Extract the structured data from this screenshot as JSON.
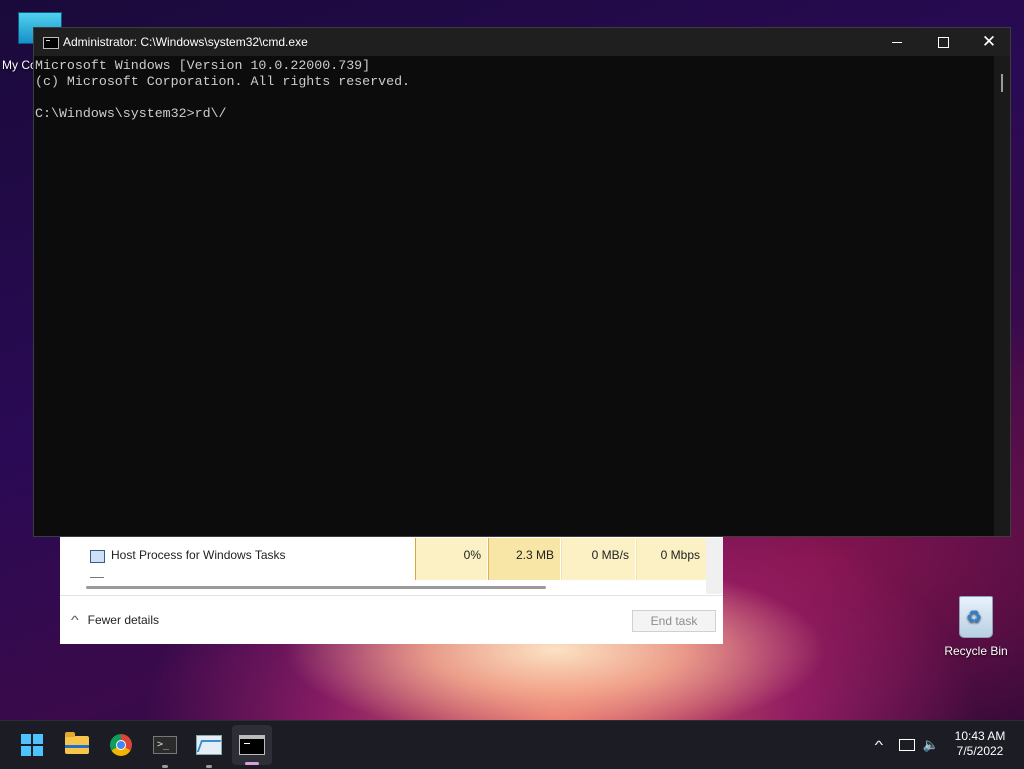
{
  "desktop": {
    "my_computer_label": "My Co",
    "recycle_bin_label": "Recycle Bin"
  },
  "taskmgr": {
    "row": {
      "name": "Host Process for Windows Tasks",
      "cpu": "0%",
      "memory": "2.3 MB",
      "disk": "0 MB/s",
      "network": "0 Mbps"
    },
    "fewer_details_label": "Fewer details",
    "end_task_label": "End task"
  },
  "cmd": {
    "title": "Administrator: C:\\Windows\\system32\\cmd.exe",
    "lines": [
      "Microsoft Windows [Version 10.0.22000.739]",
      "(c) Microsoft Corporation. All rights reserved.",
      "",
      "C:\\Windows\\system32>rd\\/"
    ]
  },
  "taskbar": {
    "apps": [
      "start-icon",
      "file-explorer-icon",
      "chrome-icon",
      "terminal-icon",
      "performance-monitor-icon",
      "cmd-icon"
    ],
    "clock_time": "10:43 AM",
    "clock_date": "7/5/2022"
  },
  "colors": {
    "cmd_bg": "#0c0c0c",
    "cmd_text": "#cccccc",
    "taskbar_bg": "#1c1c24",
    "accent": "#4cc2ff"
  }
}
